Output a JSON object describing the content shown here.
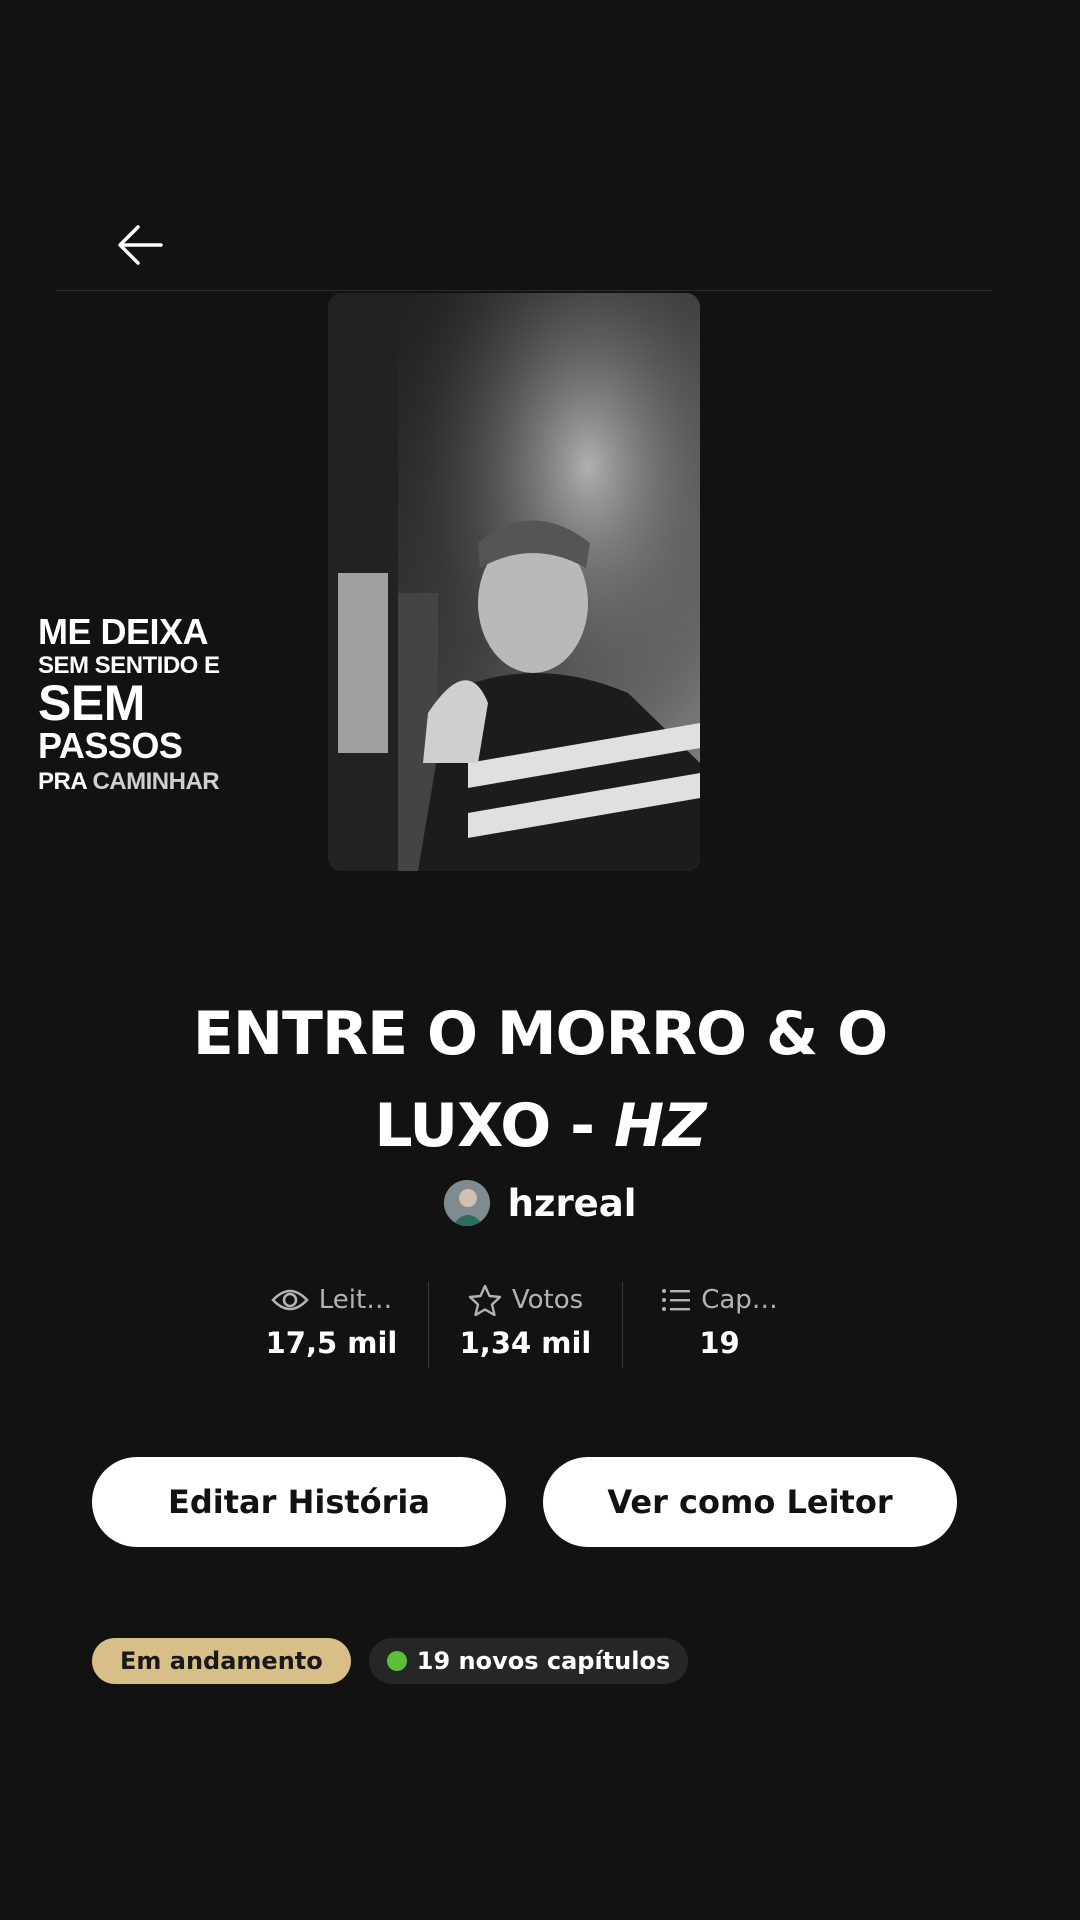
{
  "header": {
    "back_icon": "arrow-left-icon"
  },
  "cover": {
    "overlay_text": {
      "line1": "ME DEIXA",
      "line2": "SEM SENTIDO E",
      "line3": "SEM",
      "line4": "PASSOS",
      "line5_a": "PRA ",
      "line5_b": "CAMINHAR"
    }
  },
  "story": {
    "title_main": "ENTRE O MORRO & O LUXO - ",
    "title_italic": "HZ",
    "author": "hzreal"
  },
  "stats": [
    {
      "icon": "eye-icon",
      "label": "Leit…",
      "value": "17,5 mil"
    },
    {
      "icon": "star-icon",
      "label": "Votos",
      "value": "1,34 mil"
    },
    {
      "icon": "list-icon",
      "label": "Cap…",
      "value": "19"
    }
  ],
  "actions": {
    "edit_label": "Editar História",
    "read_label": "Ver como Leitor"
  },
  "tags": {
    "status": "Em andamento",
    "new_chapters": "19 novos capítulos"
  },
  "colors": {
    "background": "#121212",
    "status_tag": "#d8bf88",
    "new_dot": "#5cbf3a"
  }
}
